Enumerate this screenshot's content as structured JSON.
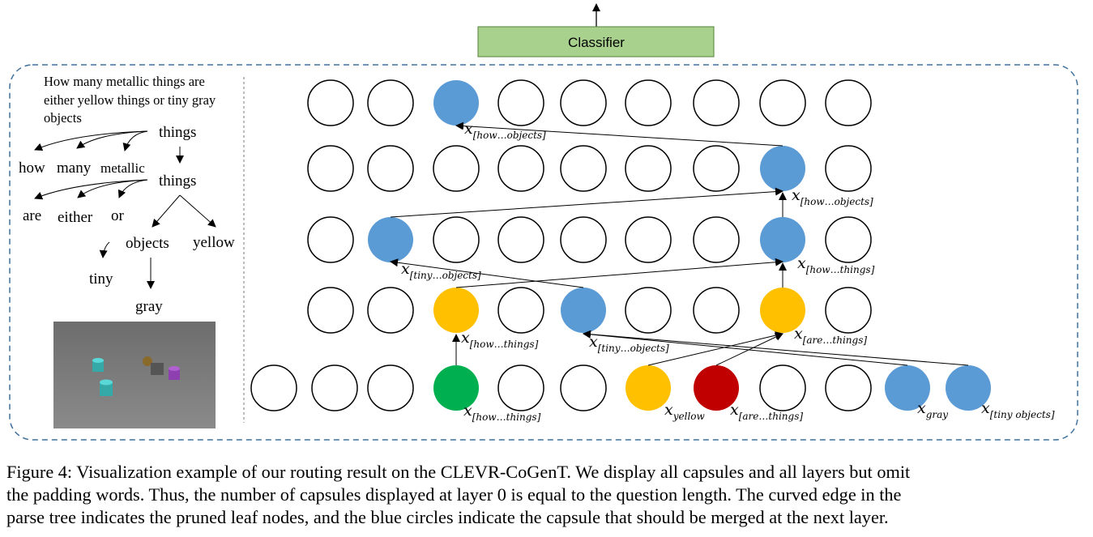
{
  "classifier": {
    "label": "Classifier",
    "fill": "#a9d18e"
  },
  "question": [
    "How many metallic things are",
    "either yellow things or tiny gray",
    "objects"
  ],
  "tree_words": {
    "root": "things",
    "how": "how",
    "many": "many",
    "metallic": "metallic",
    "things2": "things",
    "are": "are",
    "either": "either",
    "or": "or",
    "objects": "objects",
    "yellow": "yellow",
    "tiny": "tiny",
    "gray": "gray"
  },
  "colors": {
    "blue": "#5b9bd5",
    "yellow": "#ffc000",
    "green": "#00b050",
    "red": "#c00000",
    "frame": "#41719c"
  },
  "layers": [
    {
      "layer": 0,
      "capsules": [
        "empty",
        "empty",
        "empty",
        "green",
        "empty",
        "empty",
        "yellow",
        "red",
        "empty",
        "empty",
        "blue",
        "blue"
      ]
    },
    {
      "layer": 1,
      "capsules": [
        "empty",
        "empty",
        "yellow",
        "empty",
        "blue",
        "empty",
        "empty",
        "yellow",
        "empty"
      ]
    },
    {
      "layer": 2,
      "capsules": [
        "empty",
        "blue",
        "empty",
        "empty",
        "empty",
        "empty",
        "empty",
        "blue",
        "empty"
      ]
    },
    {
      "layer": 3,
      "capsules": [
        "empty",
        "empty",
        "empty",
        "empty",
        "empty",
        "empty",
        "empty",
        "blue",
        "empty"
      ]
    },
    {
      "layer": 4,
      "capsules": [
        "empty",
        "empty",
        "blue",
        "empty",
        "empty",
        "empty",
        "empty",
        "empty",
        "empty"
      ]
    }
  ],
  "labels": {
    "l4_how_objects": {
      "base": "x",
      "sub": "[how…objects]"
    },
    "l3_how_objects": {
      "base": "x",
      "sub": "[how…objects]"
    },
    "l2_how_things": {
      "base": "x",
      "sub": "[how…things]"
    },
    "l2_tiny_objects": {
      "base": "x",
      "sub": "[tiny…objects]"
    },
    "l1_how_things": {
      "base": "x",
      "sub": "[how…things]"
    },
    "l1_tiny_objects": {
      "base": "x",
      "sub": "[tiny…objects]"
    },
    "l1_are_things": {
      "base": "x",
      "sub": "[are…things]"
    },
    "l0_how_things": {
      "base": "x",
      "sub": "[how…things]"
    },
    "l0_yellow": {
      "base": "x",
      "sub": "yellow"
    },
    "l0_are_things": {
      "base": "x",
      "sub": "[are…things]"
    },
    "l0_gray": {
      "base": "x",
      "sub": "gray"
    },
    "l0_tiny_objects": {
      "base": "x",
      "sub": "[tiny objects]"
    }
  },
  "caption": [
    "Figure 4: Visualization example of our routing result on the CLEVR-CoGenT. We display all capsules and all layers but omit",
    "the padding words. Thus, the number of capsules displayed at layer 0 is equal to the question length. The curved edge in the",
    "parse tree indicates the pruned leaf nodes, and the blue circles indicate the capsule that should be merged at the next layer."
  ]
}
